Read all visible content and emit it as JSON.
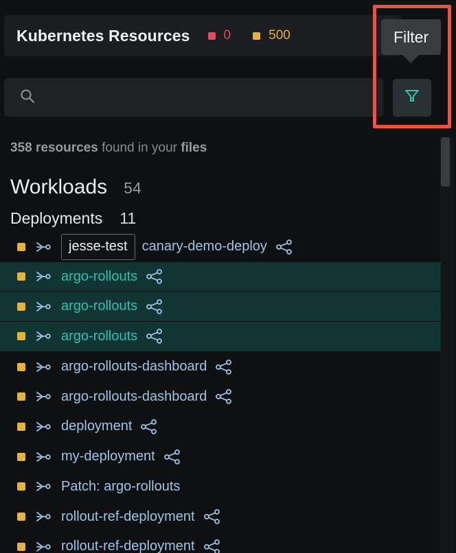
{
  "header": {
    "title": "Kubernetes Resources",
    "error_count": "0",
    "warning_count": "500",
    "colors": {
      "error": "#e8495e",
      "warning": "#e6b23b"
    }
  },
  "tooltip": {
    "label": "Filter"
  },
  "search": {
    "value": "",
    "placeholder": "",
    "icon": "search-icon"
  },
  "filter_button": {
    "icon": "filter-icon",
    "accent": "#2fc0b3"
  },
  "summary": {
    "count": "358 resources",
    "middle": " found in your ",
    "location": "files"
  },
  "section": {
    "title": "Workloads",
    "count": "54"
  },
  "subsection": {
    "title": "Deployments",
    "count": "11"
  },
  "rows": [
    {
      "namespace": "jesse-test",
      "name": "canary-demo-deploy",
      "selected": false,
      "share": true
    },
    {
      "namespace": "",
      "name": "argo-rollouts",
      "selected": true,
      "share": true
    },
    {
      "namespace": "",
      "name": "argo-rollouts",
      "selected": true,
      "share": true
    },
    {
      "namespace": "",
      "name": "argo-rollouts",
      "selected": true,
      "share": true
    },
    {
      "namespace": "",
      "name": "argo-rollouts-dashboard",
      "selected": false,
      "share": true
    },
    {
      "namespace": "",
      "name": "argo-rollouts-dashboard",
      "selected": false,
      "share": true
    },
    {
      "namespace": "",
      "name": "deployment",
      "selected": false,
      "share": true
    },
    {
      "namespace": "",
      "name": "my-deployment",
      "selected": false,
      "share": true
    },
    {
      "namespace": "",
      "name": "Patch: argo-rollouts",
      "selected": false,
      "share": false
    },
    {
      "namespace": "",
      "name": "rollout-ref-deployment",
      "selected": false,
      "share": true
    },
    {
      "namespace": "",
      "name": "rollout-ref-deployment",
      "selected": false,
      "share": true
    }
  ]
}
